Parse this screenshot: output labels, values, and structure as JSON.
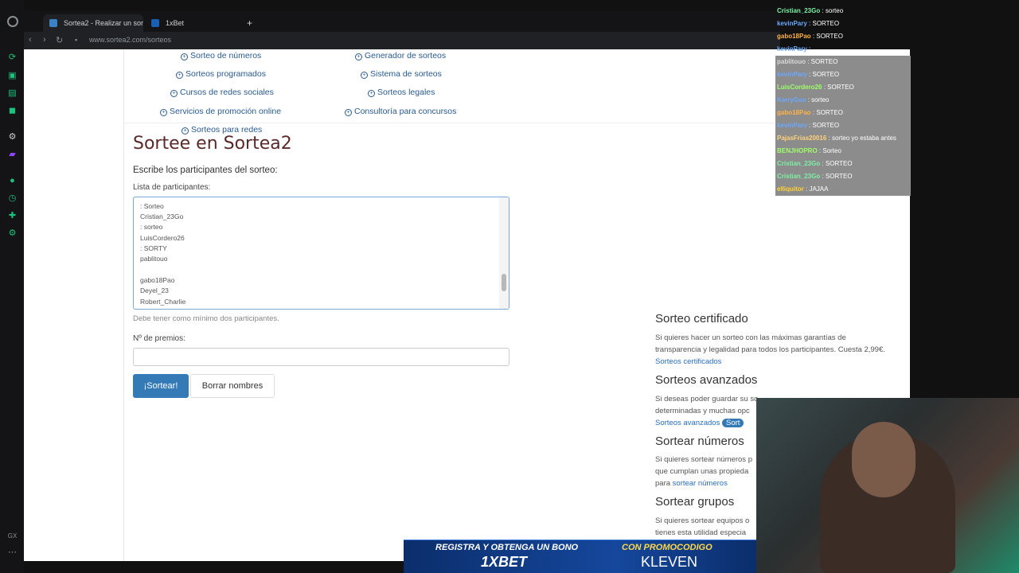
{
  "browser": {
    "tabs": [
      {
        "label": "Sortea2 - Realizar un sort"
      },
      {
        "label": "1xBet"
      }
    ],
    "new_tab_symbol": "+",
    "url": "www.sortea2.com/sorteos"
  },
  "links": [
    {
      "label": "Sorteo de números"
    },
    {
      "label": "Generador de sorteos"
    },
    {
      "label": "Sorteos programados"
    },
    {
      "label": "Sistema de sorteos"
    },
    {
      "label": "Cursos de redes sociales"
    },
    {
      "label": "Sorteos legales"
    },
    {
      "label": "Servicios de promoción online"
    },
    {
      "label": "Consultoría para concursos"
    },
    {
      "label": "Sorteos para redes"
    }
  ],
  "main": {
    "title": "Sortee en Sortea2",
    "participants_heading": "Escribe los participantes del sorteo:",
    "list_label": "Lista de participantes:",
    "participants_lines": [
      ": Sorteo",
      "Cristian_23Go",
      ": sorteo",
      "LuisCordero26",
      ": SORTY",
      "pablitouo",
      "",
      "gabo18Pao",
      "Deyel_23",
      "Robert_Charlie"
    ],
    "min_note": "Debe tener como mínimo dos participantes.",
    "prizes_label": "Nº de premios:",
    "prizes_value": "",
    "draw_button": "¡Sortear!",
    "clear_button": "Borrar nombres"
  },
  "sidebar": {
    "certified_title": "Sorteo certificado",
    "certified_text": "Si quieres hacer un sorteo con las máximas garantías de transparencia y legalidad para todos los participantes. Cuesta 2,99€.",
    "certified_link": "Sorteos certificados",
    "advanced_title": "Sorteos avanzados",
    "advanced_text": "Si deseas poder guardar su so",
    "advanced_text2": "determinadas y muchas opc",
    "advanced_link": "Sorteos avanzados",
    "advanced_pill": "Sort",
    "numbers_title": "Sortear números",
    "numbers_text": "Si quieres sortear números p",
    "numbers_text2": "que cumplan unas propieda",
    "numbers_text3": "para",
    "numbers_link": "sortear números",
    "groups_title": "Sortear grupos",
    "groups_text": "Si quieres sortear equipos o",
    "groups_text2": "tienes esta utilidad especia"
  },
  "chat": [
    {
      "user": "Cristian_23Go",
      "msg": ": sorteo",
      "color": "#7cf2a4",
      "bg": false
    },
    {
      "user": "kevinPary",
      "msg": ": SORTEO",
      "color": "#6aa8ff",
      "bg": false
    },
    {
      "user": "gabo18Pao",
      "msg": ": SORTEO",
      "color": "#ffb347",
      "bg": false
    },
    {
      "user": "kevinPary",
      "msg": ":",
      "color": "#6aa8ff",
      "bg": false
    },
    {
      "user": "pablitouo",
      "msg": ": SORTEO",
      "color": "#d8d8d8",
      "bg": true
    },
    {
      "user": "kevinPary",
      "msg": ": SORTEO",
      "color": "#6aa8ff",
      "bg": true
    },
    {
      "user": "LuisCordero26",
      "msg": ": SORTEO",
      "color": "#9dff6a",
      "bg": true
    },
    {
      "user": "KarryGus",
      "msg": ": sorteo",
      "color": "#6aa8ff",
      "bg": true
    },
    {
      "user": "gabo18Pao",
      "msg": ": SORTEO",
      "color": "#ffb347",
      "bg": true
    },
    {
      "user": "kevinPary",
      "msg": ": SORTEO",
      "color": "#6aa8ff",
      "bg": true
    },
    {
      "user": "PajasFrias20016",
      "msg": ": sorteo yo estaba antes",
      "color": "#ffd27a",
      "bg": true
    },
    {
      "user": "BENJHOPRO",
      "msg": ": Sorteo",
      "color": "#9dff6a",
      "bg": true
    },
    {
      "user": "Cristian_23Go",
      "msg": ": SORTEO",
      "color": "#7cf2a4",
      "bg": true
    },
    {
      "user": "Cristian_23Go",
      "msg": ": SORTEO",
      "color": "#7cf2a4",
      "bg": true
    },
    {
      "user": "elliquitor",
      "msg": ": JAJAA",
      "color": "#ffd22e",
      "bg": true
    }
  ],
  "banner": {
    "line1_left": "REGISTRA Y OBTENGA UN BONO",
    "brand": "1XBET",
    "line1_right": "CON PROMOCODIGO",
    "code": "KLEVEN"
  },
  "colors": {
    "accent": "#337ab7",
    "link": "#2a5a8e",
    "title": "#5a2a2a"
  }
}
